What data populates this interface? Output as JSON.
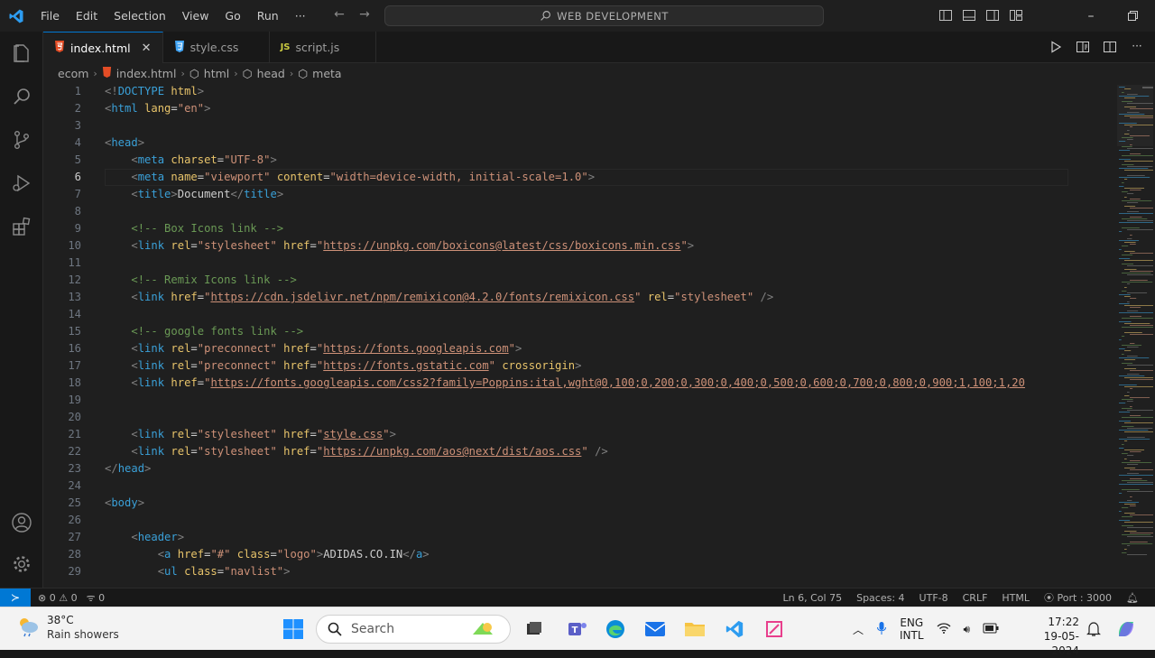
{
  "menu": [
    "File",
    "Edit",
    "Selection",
    "View",
    "Go",
    "Run",
    "···"
  ],
  "command_center": "WEB DEVELOPMENT",
  "tabs": [
    {
      "label": "index.html",
      "icon": "html-file-icon",
      "active": true
    },
    {
      "label": "style.css",
      "icon": "css-file-icon",
      "active": false
    },
    {
      "label": "script.js",
      "icon": "js-file-icon",
      "active": false
    }
  ],
  "breadcrumb": [
    "ecom",
    "index.html",
    "html",
    "head",
    "meta"
  ],
  "current_line": 6,
  "code_lines": [
    [
      {
        "t": "tag",
        "v": "<!"
      },
      {
        "t": "tn",
        "v": "DOCTYPE"
      },
      {
        "t": "",
        "v": " "
      },
      {
        "t": "attr",
        "v": "html"
      },
      {
        "t": "tag",
        "v": ">"
      }
    ],
    [
      {
        "t": "tag",
        "v": "<"
      },
      {
        "t": "tn",
        "v": "html"
      },
      {
        "t": "",
        "v": " "
      },
      {
        "t": "attr",
        "v": "lang"
      },
      {
        "t": "",
        "v": "="
      },
      {
        "t": "str",
        "v": "\"en\""
      },
      {
        "t": "tag",
        "v": ">"
      }
    ],
    [],
    [
      {
        "t": "tag",
        "v": "<"
      },
      {
        "t": "tn",
        "v": "head"
      },
      {
        "t": "tag",
        "v": ">"
      }
    ],
    [
      {
        "t": "",
        "v": "    "
      },
      {
        "t": "tag",
        "v": "<"
      },
      {
        "t": "tn",
        "v": "meta"
      },
      {
        "t": "",
        "v": " "
      },
      {
        "t": "attr",
        "v": "charset"
      },
      {
        "t": "",
        "v": "="
      },
      {
        "t": "str",
        "v": "\"UTF-8\""
      },
      {
        "t": "tag",
        "v": ">"
      }
    ],
    [
      {
        "t": "",
        "v": "    "
      },
      {
        "t": "tag",
        "v": "<"
      },
      {
        "t": "tn",
        "v": "meta"
      },
      {
        "t": "",
        "v": " "
      },
      {
        "t": "attr",
        "v": "name"
      },
      {
        "t": "",
        "v": "="
      },
      {
        "t": "str",
        "v": "\"viewport\""
      },
      {
        "t": "",
        "v": " "
      },
      {
        "t": "attr",
        "v": "content"
      },
      {
        "t": "",
        "v": "="
      },
      {
        "t": "str",
        "v": "\"width=device-width, initial-scale=1.0\""
      },
      {
        "t": "tag",
        "v": ">"
      }
    ],
    [
      {
        "t": "",
        "v": "    "
      },
      {
        "t": "tag",
        "v": "<"
      },
      {
        "t": "tn",
        "v": "title"
      },
      {
        "t": "tag",
        "v": ">"
      },
      {
        "t": "",
        "v": "Document"
      },
      {
        "t": "tag",
        "v": "</"
      },
      {
        "t": "tn",
        "v": "title"
      },
      {
        "t": "tag",
        "v": ">"
      }
    ],
    [],
    [
      {
        "t": "",
        "v": "    "
      },
      {
        "t": "cmt",
        "v": "<!-- Box Icons link -->"
      }
    ],
    [
      {
        "t": "",
        "v": "    "
      },
      {
        "t": "tag",
        "v": "<"
      },
      {
        "t": "tn",
        "v": "link"
      },
      {
        "t": "",
        "v": " "
      },
      {
        "t": "attr",
        "v": "rel"
      },
      {
        "t": "",
        "v": "="
      },
      {
        "t": "str",
        "v": "\"stylesheet\""
      },
      {
        "t": "",
        "v": " "
      },
      {
        "t": "attr",
        "v": "href"
      },
      {
        "t": "",
        "v": "="
      },
      {
        "t": "str",
        "v": "\""
      },
      {
        "t": "url",
        "v": "https://unpkg.com/boxicons@latest/css/boxicons.min.css"
      },
      {
        "t": "str",
        "v": "\""
      },
      {
        "t": "tag",
        "v": ">"
      }
    ],
    [],
    [
      {
        "t": "",
        "v": "    "
      },
      {
        "t": "cmt",
        "v": "<!-- Remix Icons link -->"
      }
    ],
    [
      {
        "t": "",
        "v": "    "
      },
      {
        "t": "tag",
        "v": "<"
      },
      {
        "t": "tn",
        "v": "link"
      },
      {
        "t": "",
        "v": " "
      },
      {
        "t": "attr",
        "v": "href"
      },
      {
        "t": "",
        "v": "="
      },
      {
        "t": "str",
        "v": "\""
      },
      {
        "t": "url",
        "v": "https://cdn.jsdelivr.net/npm/remixicon@4.2.0/fonts/remixicon.css"
      },
      {
        "t": "str",
        "v": "\""
      },
      {
        "t": "",
        "v": " "
      },
      {
        "t": "attr",
        "v": "rel"
      },
      {
        "t": "",
        "v": "="
      },
      {
        "t": "str",
        "v": "\"stylesheet\""
      },
      {
        "t": "",
        "v": " "
      },
      {
        "t": "tag",
        "v": "/>"
      }
    ],
    [],
    [
      {
        "t": "",
        "v": "    "
      },
      {
        "t": "cmt",
        "v": "<!-- google fonts link -->"
      }
    ],
    [
      {
        "t": "",
        "v": "    "
      },
      {
        "t": "tag",
        "v": "<"
      },
      {
        "t": "tn",
        "v": "link"
      },
      {
        "t": "",
        "v": " "
      },
      {
        "t": "attr",
        "v": "rel"
      },
      {
        "t": "",
        "v": "="
      },
      {
        "t": "str",
        "v": "\"preconnect\""
      },
      {
        "t": "",
        "v": " "
      },
      {
        "t": "attr",
        "v": "href"
      },
      {
        "t": "",
        "v": "="
      },
      {
        "t": "str",
        "v": "\""
      },
      {
        "t": "url",
        "v": "https://fonts.googleapis.com"
      },
      {
        "t": "str",
        "v": "\""
      },
      {
        "t": "tag",
        "v": ">"
      }
    ],
    [
      {
        "t": "",
        "v": "    "
      },
      {
        "t": "tag",
        "v": "<"
      },
      {
        "t": "tn",
        "v": "link"
      },
      {
        "t": "",
        "v": " "
      },
      {
        "t": "attr",
        "v": "rel"
      },
      {
        "t": "",
        "v": "="
      },
      {
        "t": "str",
        "v": "\"preconnect\""
      },
      {
        "t": "",
        "v": " "
      },
      {
        "t": "attr",
        "v": "href"
      },
      {
        "t": "",
        "v": "="
      },
      {
        "t": "str",
        "v": "\""
      },
      {
        "t": "url",
        "v": "https://fonts.gstatic.com"
      },
      {
        "t": "str",
        "v": "\""
      },
      {
        "t": "",
        "v": " "
      },
      {
        "t": "attr",
        "v": "crossorigin"
      },
      {
        "t": "tag",
        "v": ">"
      }
    ],
    [
      {
        "t": "",
        "v": "    "
      },
      {
        "t": "tag",
        "v": "<"
      },
      {
        "t": "tn",
        "v": "link"
      },
      {
        "t": "",
        "v": " "
      },
      {
        "t": "attr",
        "v": "href"
      },
      {
        "t": "",
        "v": "="
      },
      {
        "t": "str",
        "v": "\""
      },
      {
        "t": "url",
        "v": "https://fonts.googleapis.com/css2?family=Poppins:ital,wght@0,100;0,200;0,300;0,400;0,500;0,600;0,700;0,800;0,900;1,100;1,20"
      }
    ],
    [],
    [],
    [
      {
        "t": "",
        "v": "    "
      },
      {
        "t": "tag",
        "v": "<"
      },
      {
        "t": "tn",
        "v": "link"
      },
      {
        "t": "",
        "v": " "
      },
      {
        "t": "attr",
        "v": "rel"
      },
      {
        "t": "",
        "v": "="
      },
      {
        "t": "str",
        "v": "\"stylesheet\""
      },
      {
        "t": "",
        "v": " "
      },
      {
        "t": "attr",
        "v": "href"
      },
      {
        "t": "",
        "v": "="
      },
      {
        "t": "str",
        "v": "\""
      },
      {
        "t": "url",
        "v": "style.css"
      },
      {
        "t": "str",
        "v": "\""
      },
      {
        "t": "tag",
        "v": ">"
      }
    ],
    [
      {
        "t": "",
        "v": "    "
      },
      {
        "t": "tag",
        "v": "<"
      },
      {
        "t": "tn",
        "v": "link"
      },
      {
        "t": "",
        "v": " "
      },
      {
        "t": "attr",
        "v": "rel"
      },
      {
        "t": "",
        "v": "="
      },
      {
        "t": "str",
        "v": "\"stylesheet\""
      },
      {
        "t": "",
        "v": " "
      },
      {
        "t": "attr",
        "v": "href"
      },
      {
        "t": "",
        "v": "="
      },
      {
        "t": "str",
        "v": "\""
      },
      {
        "t": "url",
        "v": "https://unpkg.com/aos@next/dist/aos.css"
      },
      {
        "t": "str",
        "v": "\""
      },
      {
        "t": "",
        "v": " "
      },
      {
        "t": "tag",
        "v": "/>"
      }
    ],
    [
      {
        "t": "tag",
        "v": "</"
      },
      {
        "t": "tn",
        "v": "head"
      },
      {
        "t": "tag",
        "v": ">"
      }
    ],
    [],
    [
      {
        "t": "tag",
        "v": "<"
      },
      {
        "t": "tn",
        "v": "body"
      },
      {
        "t": "tag",
        "v": ">"
      }
    ],
    [],
    [
      {
        "t": "",
        "v": "    "
      },
      {
        "t": "tag",
        "v": "<"
      },
      {
        "t": "tn",
        "v": "header"
      },
      {
        "t": "tag",
        "v": ">"
      }
    ],
    [
      {
        "t": "",
        "v": "        "
      },
      {
        "t": "tag",
        "v": "<"
      },
      {
        "t": "tn",
        "v": "a"
      },
      {
        "t": "",
        "v": " "
      },
      {
        "t": "attr",
        "v": "href"
      },
      {
        "t": "",
        "v": "="
      },
      {
        "t": "str",
        "v": "\"#\""
      },
      {
        "t": "",
        "v": " "
      },
      {
        "t": "attr",
        "v": "class"
      },
      {
        "t": "",
        "v": "="
      },
      {
        "t": "str",
        "v": "\"logo\""
      },
      {
        "t": "tag",
        "v": ">"
      },
      {
        "t": "",
        "v": "ADIDAS.CO.IN"
      },
      {
        "t": "tag",
        "v": "</"
      },
      {
        "t": "tn",
        "v": "a"
      },
      {
        "t": "tag",
        "v": ">"
      }
    ],
    [
      {
        "t": "",
        "v": "        "
      },
      {
        "t": "tag",
        "v": "<"
      },
      {
        "t": "tn",
        "v": "ul"
      },
      {
        "t": "",
        "v": " "
      },
      {
        "t": "attr",
        "v": "class"
      },
      {
        "t": "",
        "v": "="
      },
      {
        "t": "str",
        "v": "\"navlist\""
      },
      {
        "t": "tag",
        "v": ">"
      }
    ]
  ],
  "status": {
    "errors": "0",
    "warnings": "0",
    "ports": "0",
    "position": "Ln 6, Col 75",
    "spaces": "Spaces: 4",
    "encoding": "UTF-8",
    "eol": "CRLF",
    "language": "HTML",
    "port": "Port : 3000"
  },
  "taskbar": {
    "temperature": "38°C",
    "weather": "Rain showers",
    "search_placeholder": "Search",
    "lang_line1": "ENG",
    "lang_line2": "INTL",
    "time": "17:22",
    "date": "19-05-2024"
  },
  "colors": {
    "accent": "#0078d4",
    "editor_bg": "#1f1f1f",
    "html_icon": "#e44d26",
    "css_icon": "#42a5f5",
    "js_icon": "#cbcb41"
  }
}
